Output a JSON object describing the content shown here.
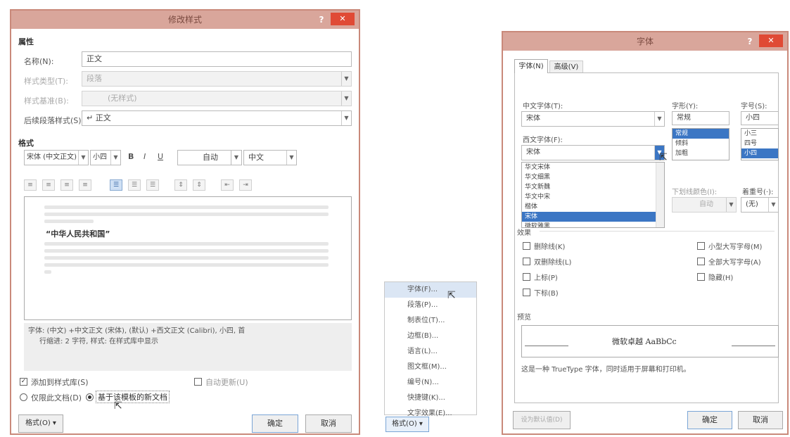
{
  "style_dialog": {
    "title": "修改样式",
    "help": "?",
    "close": "✕",
    "section_properties": "属性",
    "name_label": "名称(N):",
    "name_value": "正文",
    "type_label": "样式类型(T):",
    "type_value": "段落",
    "based_label": "样式基准(B):",
    "based_value": "(无样式)",
    "next_label": "后续段落样式(S):",
    "next_value": "↵ 正文",
    "section_format": "格式",
    "font_value": "宋体 (中文正文)",
    "size_value": "小四",
    "bold": "B",
    "italic": "I",
    "underline": "U",
    "color_value": "自动",
    "lang_value": "中文",
    "preview_sample": "“中华人民共和国”",
    "description_line1": "字体: (中文) +中文正文 (宋体), (默认) +西文正文 (Calibri), 小四, 首",
    "description_line2": "行缩进: 2 字符, 样式: 在样式库中显示",
    "add_to_gallery": "添加到样式库(S)",
    "auto_update": "自动更新(U)",
    "only_this_doc": "仅限此文档(D)",
    "new_docs_template": "基于该模板的新文档",
    "format_button": "格式(O) ▾",
    "ok": "确定",
    "cancel": "取消"
  },
  "format_menu": {
    "items": [
      "字体(F)...",
      "段落(P)...",
      "制表位(T)...",
      "边框(B)...",
      "语言(L)...",
      "图文框(M)...",
      "编号(N)...",
      "快捷键(K)...",
      "文字效果(E)..."
    ],
    "button": "格式(O) ▾"
  },
  "font_dialog": {
    "title": "字体",
    "help": "?",
    "close": "✕",
    "tab_font": "字体(N)",
    "tab_advanced": "高级(V)",
    "cn_font_label": "中文字体(T):",
    "cn_font_value": "宋体",
    "style_label": "字形(Y):",
    "style_value": "常规",
    "style_list": [
      "常规",
      "倾斜",
      "加粗"
    ],
    "size_label": "字号(S):",
    "size_value": "小四",
    "size_list": [
      "小三",
      "四号",
      "小四"
    ],
    "west_font_label": "西文字体(F):",
    "west_font_value": "宋体",
    "font_dropdown": [
      "华文宋体",
      "华文细黑",
      "华文新魏",
      "华文中宋",
      "楷体",
      "宋体",
      "微软雅黑"
    ],
    "underline_color_label": "下划线颜色(I):",
    "underline_color_value": "自动",
    "emphasis_label": "着重号(·):",
    "emphasis_value": "(无)",
    "effects_label": "效果",
    "effects_left": [
      "删除线(K)",
      "双删除线(L)",
      "上标(P)",
      "下标(B)"
    ],
    "effects_right": [
      "小型大写字母(M)",
      "全部大写字母(A)",
      "隐藏(H)"
    ],
    "preview_label": "预览",
    "preview_text": "微软卓越  AaBbCc",
    "preview_note": "这是一种 TrueType 字体，同时适用于屏幕和打印机。",
    "set_default": "设为默认值(D)",
    "ok": "确定",
    "cancel": "取消"
  },
  "colors": {
    "titlebar": "#d9a69b",
    "close": "#e04a35",
    "selection": "#3b76c4",
    "menu_highlight": "#dbe6f4"
  }
}
